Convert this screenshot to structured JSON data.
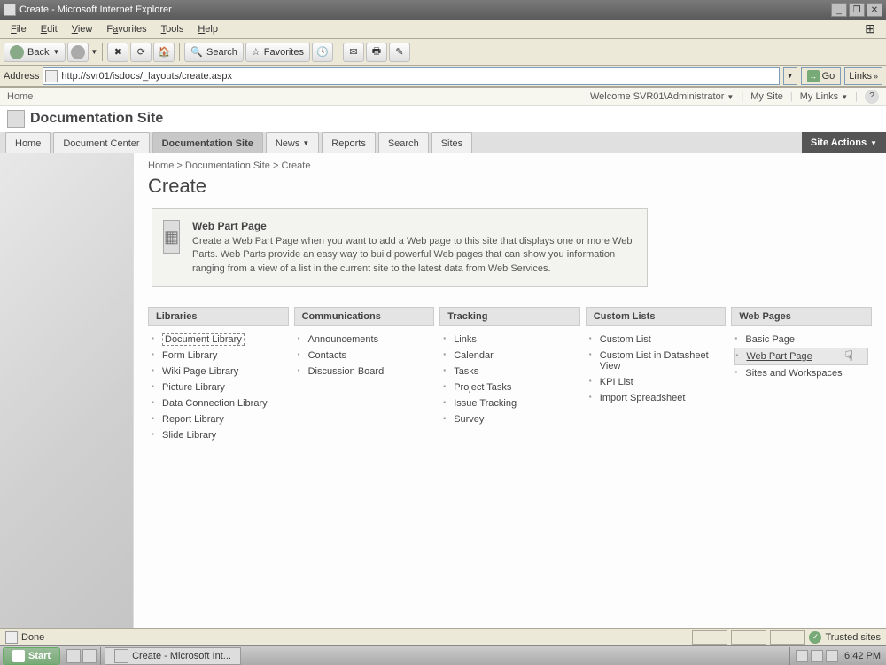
{
  "window": {
    "title": "Create - Microsoft Internet Explorer"
  },
  "menubar": [
    "File",
    "Edit",
    "View",
    "Favorites",
    "Tools",
    "Help"
  ],
  "toolbar": {
    "back": "Back",
    "search": "Search",
    "favorites": "Favorites"
  },
  "addressbar": {
    "label": "Address",
    "url": "http://svr01/isdocs/_layouts/create.aspx",
    "go": "Go",
    "links": "Links"
  },
  "sp_top": {
    "home": "Home",
    "welcome": "Welcome SVR01\\Administrator",
    "mysite": "My Site",
    "mylinks": "My Links"
  },
  "site_title": "Documentation Site",
  "nav_tabs": [
    "Home",
    "Document Center",
    "Documentation Site",
    "News",
    "Reports",
    "Search",
    "Sites"
  ],
  "nav_active_index": 2,
  "site_actions": "Site Actions",
  "breadcrumb": {
    "a": "Home",
    "b": "Documentation Site",
    "c": "Create"
  },
  "page_heading": "Create",
  "infobox": {
    "title": "Web Part Page",
    "desc": "Create a Web Part Page when you want to add a Web page to this site that displays one or more Web Parts. Web Parts provide an easy way to build powerful Web pages that can show you information ranging from a view of a list in the current site to the latest data from Web Services."
  },
  "categories": [
    {
      "title": "Libraries",
      "items": [
        "Document Library",
        "Form Library",
        "Wiki Page Library",
        "Picture Library",
        "Data Connection Library",
        "Report Library",
        "Slide Library"
      ]
    },
    {
      "title": "Communications",
      "items": [
        "Announcements",
        "Contacts",
        "Discussion Board"
      ]
    },
    {
      "title": "Tracking",
      "items": [
        "Links",
        "Calendar",
        "Tasks",
        "Project Tasks",
        "Issue Tracking",
        "Survey"
      ]
    },
    {
      "title": "Custom Lists",
      "items": [
        "Custom List",
        "Custom List in Datasheet View",
        "KPI List",
        "Import Spreadsheet"
      ]
    },
    {
      "title": "Web Pages",
      "items": [
        "Basic Page",
        "Web Part Page",
        "Sites and Workspaces"
      ]
    }
  ],
  "statusbar": {
    "status": "Done",
    "zone": "Trusted sites"
  },
  "taskbar": {
    "start": "Start",
    "task": "Create - Microsoft Int...",
    "clock": "6:42 PM"
  }
}
